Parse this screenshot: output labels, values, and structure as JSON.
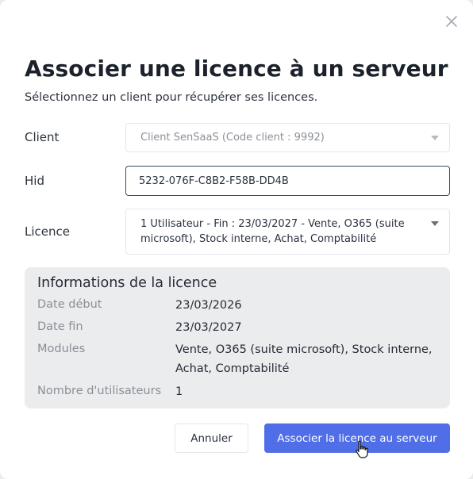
{
  "dialog": {
    "title": "Associer une licence à un serveur",
    "subtitle": "Sélectionnez un client pour récupérer ses licences."
  },
  "form": {
    "client": {
      "label": "Client",
      "value": "Client SenSaaS (Code client : 9992)"
    },
    "hid": {
      "label": "Hid",
      "value": "5232-076F-C8B2-F58B-DD4B"
    },
    "licence": {
      "label": "Licence",
      "value": "1 Utilisateur - Fin : 23/03/2027 - Vente, O365 (suite microsoft), Stock interne, Achat, Comptabilité"
    }
  },
  "info": {
    "title": "Informations de la licence",
    "rows": [
      {
        "key": "Date début",
        "value": "23/03/2026"
      },
      {
        "key": "Date fin",
        "value": "23/03/2027"
      },
      {
        "key": "Modules",
        "value": "Vente, O365 (suite microsoft), Stock interne, Achat, Comptabilité"
      },
      {
        "key": "Nombre d'utilisateurs",
        "value": "1"
      }
    ]
  },
  "buttons": {
    "cancel": "Annuler",
    "submit": "Associer la licence au serveur"
  },
  "icons": {
    "close": "close-icon",
    "dropdown": "chevron-down-icon",
    "cursor": "hand-pointer-cursor"
  },
  "colors": {
    "primary": "#4f6ee8",
    "panel": "#ebecee",
    "focus_border": "#3d4a66"
  }
}
